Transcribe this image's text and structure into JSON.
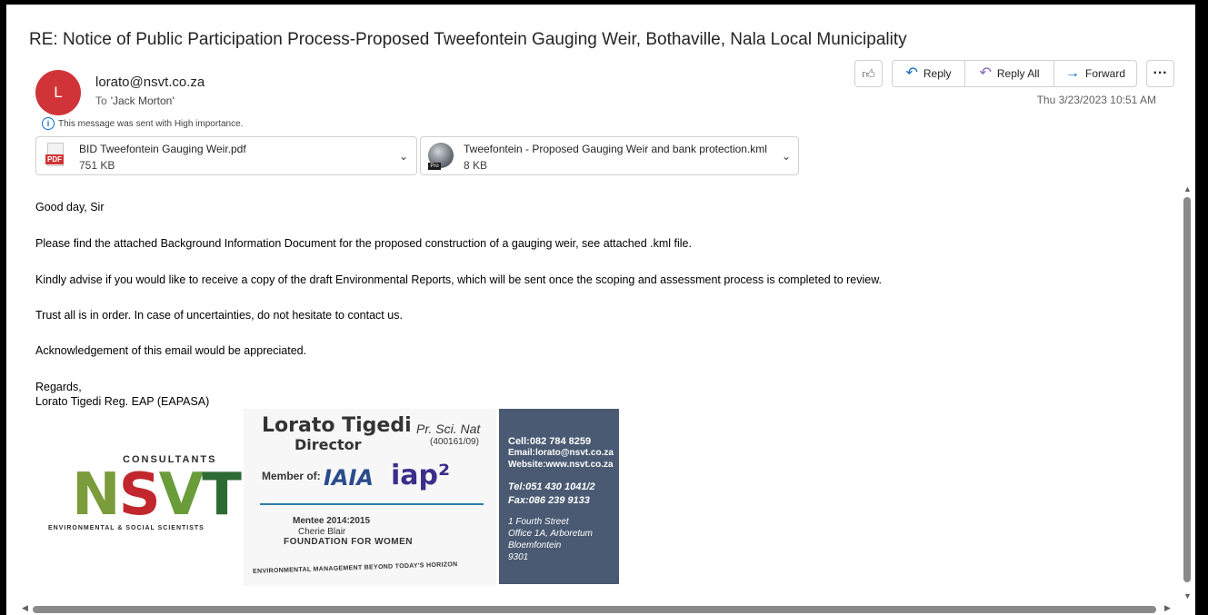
{
  "message": {
    "subject": "RE: Notice of Public Participation Process-Proposed Tweefontein Gauging Weir, Bothaville, Nala Local Municipality",
    "sender_initial": "L",
    "sender_email": "lorato@nsvt.co.za",
    "to_label": "To",
    "to_name": "'Jack Morton'",
    "importance_notice": "This message was sent with High importance.",
    "date": "Thu 3/23/2023 10:51 AM"
  },
  "attachments": [
    {
      "name": "BID Tweefontein Gauging Weir.pdf",
      "size": "751 KB",
      "icon": "pdf-icon",
      "tag": "PDF"
    },
    {
      "name": "Tweefontein - Proposed Gauging Weir and bank protection.kml",
      "size": "8 KB",
      "icon": "kml-icon",
      "tag": "Pro"
    }
  ],
  "actions": {
    "reply": "Reply",
    "reply_all": "Reply All",
    "forward": "Forward"
  },
  "body": {
    "greeting": "Good day, Sir",
    "p1": "Please find the attached Background Information Document for the proposed construction of a gauging weir, see attached .kml file.",
    "p2": "Kindly advise if you would like to receive a copy of the draft Environmental Reports, which will be sent once the scoping and assessment process is completed to review.",
    "p3": "Trust all is in order.  In case of uncertainties, do not hesitate to contact us.",
    "p4": "Acknowledgement of this email would be appreciated.",
    "regards": "Regards,",
    "signature_name": "Lorato Tigedi Reg. EAP (EAPASA)"
  },
  "signature_image": {
    "consultants": "CONSULTANTS",
    "nsvt_n": "N",
    "nsvt_s": "S",
    "nsvt_v": "V",
    "nsvt_t": "T",
    "nsvt_tagline": "ENVIRONMENTAL & SOCIAL SCIENTISTS",
    "card_name": "Lorato Tigedi",
    "card_prsci": "Pr. Sci. Nat",
    "card_title": "Director",
    "card_regno": "(400161/09)",
    "member_of": "Member of:",
    "iaia": "IAIA",
    "iap": "iap²",
    "mentee": "Mentee 2014:2015",
    "cherie": "Cherie Blair",
    "foundation": "FOUNDATION FOR WOMEN",
    "card_tagline": "ENVIRONMENTAL MANAGEMENT BEYOND TODAY'S HORIZON",
    "cell": "Cell:082 784 8259",
    "email": "Email:lorato@nsvt.co.za",
    "website": "Website:www.nsvt.co.za",
    "tel": "Tel:051 430 1041/2",
    "fax": "Fax:086 239 9133",
    "addr1": "1 Fourth Street",
    "addr2": "Office 1A, Arboretum",
    "addr3": "Bloemfontein",
    "addr4": "9301"
  }
}
